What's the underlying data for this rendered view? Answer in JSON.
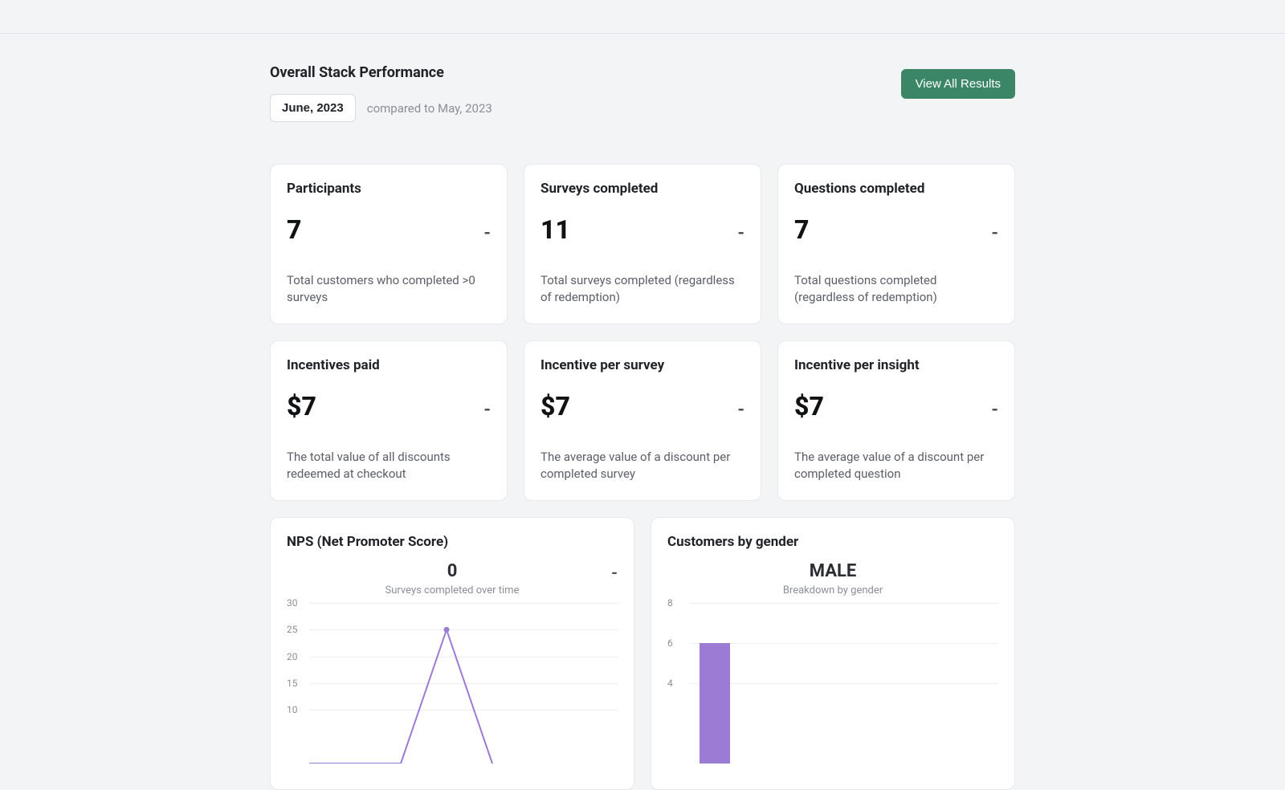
{
  "header": {
    "title": "Overall Stack Performance",
    "date_button": "June, 2023",
    "compared_text": "compared to May, 2023",
    "view_all_button": "View All Results"
  },
  "metrics": [
    {
      "title": "Participants",
      "value": "7",
      "delta": "-",
      "desc": "Total customers who completed >0 surveys"
    },
    {
      "title": "Surveys completed",
      "value": "11",
      "delta": "-",
      "desc": "Total surveys completed (regardless of redemption)"
    },
    {
      "title": "Questions completed",
      "value": "7",
      "delta": "-",
      "desc": "Total questions completed (regardless of redemption)"
    },
    {
      "title": "Incentives paid",
      "value": "$7",
      "delta": "-",
      "desc": "The total value of all discounts redeemed at checkout"
    },
    {
      "title": "Incentive per survey",
      "value": "$7",
      "delta": "-",
      "desc": "The average value of a discount per completed survey"
    },
    {
      "title": "Incentive per insight",
      "value": "$7",
      "delta": "-",
      "desc": "The average value of a discount per completed question"
    }
  ],
  "nps_chart": {
    "title": "NPS (Net Promoter Score)",
    "big_value": "0",
    "delta": "-",
    "subtitle": "Surveys completed over time"
  },
  "gender_chart": {
    "title": "Customers by gender",
    "big_value": "MALE",
    "subtitle": "Breakdown by gender"
  },
  "chart_data": [
    {
      "type": "line",
      "title": "Surveys completed over time",
      "ylabel": "",
      "ylim": [
        0,
        30
      ],
      "yticks": [
        10,
        15,
        20,
        25,
        30
      ],
      "x": [
        0,
        1,
        2,
        3,
        4
      ],
      "values": [
        0,
        0,
        0,
        25,
        0
      ],
      "color": "#9b7bd4"
    },
    {
      "type": "bar",
      "title": "Breakdown by gender",
      "ylabel": "",
      "ylim": [
        0,
        8
      ],
      "yticks": [
        4,
        6,
        8
      ],
      "categories": [
        "MALE"
      ],
      "values": [
        6
      ],
      "color": "#9b7bd4"
    }
  ]
}
